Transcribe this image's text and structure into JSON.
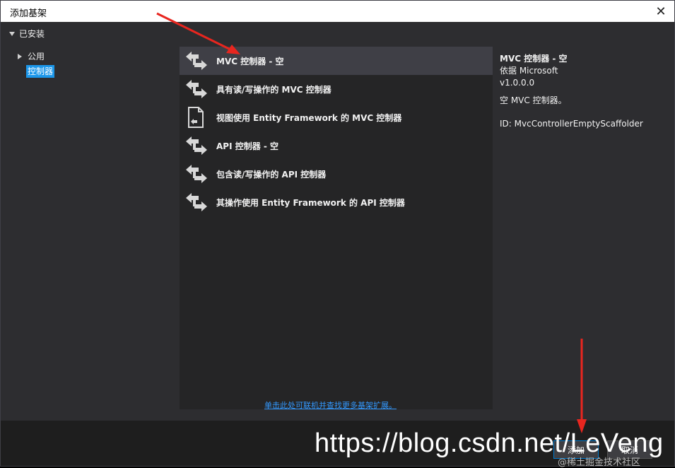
{
  "window": {
    "title": "添加基架",
    "close_glyph": "✕"
  },
  "tree": {
    "root_label": "已安装",
    "items": [
      {
        "label": "公用"
      },
      {
        "label": "控制器"
      }
    ]
  },
  "templates": [
    {
      "label": "MVC 控制器 - 空",
      "icon": "controller-icon"
    },
    {
      "label": "具有读/写操作的 MVC 控制器",
      "icon": "controller-icon"
    },
    {
      "label": "视图使用 Entity Framework 的 MVC 控制器",
      "icon": "document-controller-icon"
    },
    {
      "label": "API 控制器 - 空",
      "icon": "controller-icon"
    },
    {
      "label": "包含读/写操作的 API 控制器",
      "icon": "controller-icon"
    },
    {
      "label": "其操作使用 Entity Framework 的 API 控制器",
      "icon": "controller-icon"
    }
  ],
  "detail": {
    "name": "MVC 控制器 - 空",
    "publisher": "依据 Microsoft",
    "version": "v1.0.0.0",
    "description": "空 MVC 控制器。",
    "id": "ID: MvcControllerEmptyScaffolder"
  },
  "link_text": "单击此处可联机并查找更多基架扩展。",
  "footer": {
    "add_label": "添加",
    "cancel_label": "取消"
  },
  "watermark": {
    "url": "https://blog.csdn.net/LeVeng",
    "sub": "@稀土掘金技术社区"
  },
  "colors": {
    "accent": "#1c97ea",
    "link": "#3399ff",
    "arrow": "#e8261f"
  }
}
